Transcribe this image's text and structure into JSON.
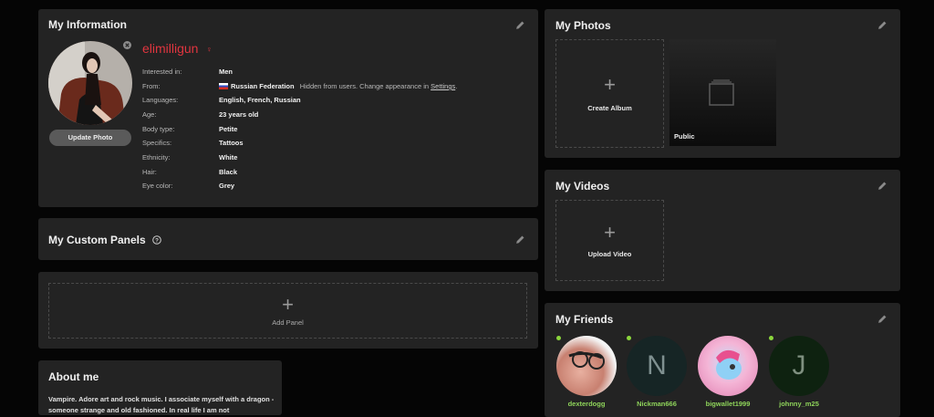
{
  "info": {
    "title": "My Information",
    "username": "elimilligun",
    "gender_icon": "female-symbol-icon",
    "update_photo": "Update Photo",
    "rows": [
      {
        "label": "Interested in:",
        "value": "Men"
      },
      {
        "label": "From:",
        "value": "Russian Federation"
      },
      {
        "label": "Languages:",
        "value": "English, French, Russian"
      },
      {
        "label": "Age:",
        "value": "23 years old"
      },
      {
        "label": "Body type:",
        "value": "Petite"
      },
      {
        "label": "Specifics:",
        "value": "Tattoos"
      },
      {
        "label": "Ethnicity:",
        "value": "White"
      },
      {
        "label": "Hair:",
        "value": "Black"
      },
      {
        "label": "Eye color:",
        "value": "Grey"
      }
    ],
    "from_note": "Hidden from users. Change appearance in",
    "from_link": "Settings",
    "from_link_end": ".",
    "accent": "#e0353f"
  },
  "custom_panels": {
    "title": "My Custom Panels",
    "add_label": "Add Panel"
  },
  "about": {
    "title": "About me",
    "text": "Vampire. Adore art and rock music. I associate myself with a dragon - someone strange and old fashioned. In real life I am not"
  },
  "photos": {
    "title": "My Photos",
    "create_album": "Create Album",
    "public_label": "Public"
  },
  "videos": {
    "title": "My Videos",
    "upload": "Upload Video"
  },
  "friends": {
    "title": "My Friends",
    "items": [
      {
        "name": "dexterdogg",
        "initial": ""
      },
      {
        "name": "Nickman666",
        "initial": "N"
      },
      {
        "name": "bigwallet1999",
        "initial": ""
      },
      {
        "name": "johnny_m25",
        "initial": "J"
      }
    ]
  }
}
